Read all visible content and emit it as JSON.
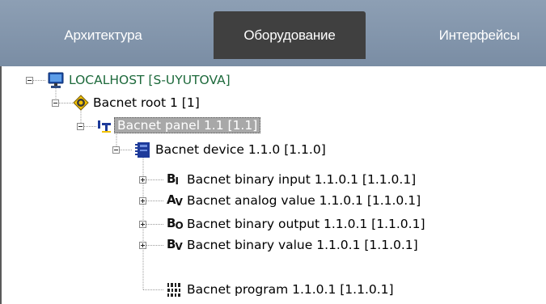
{
  "tabs": [
    {
      "label": "Архитектура",
      "active": false
    },
    {
      "label": "Оборудование",
      "active": true
    },
    {
      "label": "Интерфейсы",
      "active": false
    }
  ],
  "tree": {
    "root": {
      "label": "LOCALHOST [S-UYUTOVA]",
      "icon": "computer-icon"
    },
    "bacnet_root": {
      "label": "Bacnet root 1 [1]",
      "icon": "bacnet-root-icon"
    },
    "bacnet_panel": {
      "label": "Bacnet panel 1.1 [1.1]",
      "icon": "bacnet-panel-icon",
      "selected": true
    },
    "bacnet_device": {
      "label": "Bacnet device 1.1.0 [1.1.0]",
      "icon": "bacnet-device-icon"
    },
    "children": [
      {
        "label": "Bacnet binary input 1.1.0.1 [1.1.0.1]",
        "icon": "binary-input-icon",
        "glyph": "B",
        "sub": "I"
      },
      {
        "label": "Bacnet analog value 1.1.0.1 [1.1.0.1]",
        "icon": "analog-value-icon",
        "glyph": "A",
        "sub": "V"
      },
      {
        "label": "Bacnet binary output 1.1.0.1 [1.1.0.1]",
        "icon": "binary-output-icon",
        "glyph": "B",
        "sub": "O"
      },
      {
        "label": "Bacnet binary value 1.1.0.1 [1.1.0.1]",
        "icon": "binary-value-icon",
        "glyph": "B",
        "sub": "V"
      },
      {
        "label": "Bacnet program 1.1.0.1 [1.1.0.1]",
        "icon": "program-icon"
      }
    ]
  },
  "colors": {
    "tabbar": "#8497ad",
    "active_tab": "#404040",
    "root_label": "#1e6a3c",
    "selection": "#a8a8a8"
  }
}
